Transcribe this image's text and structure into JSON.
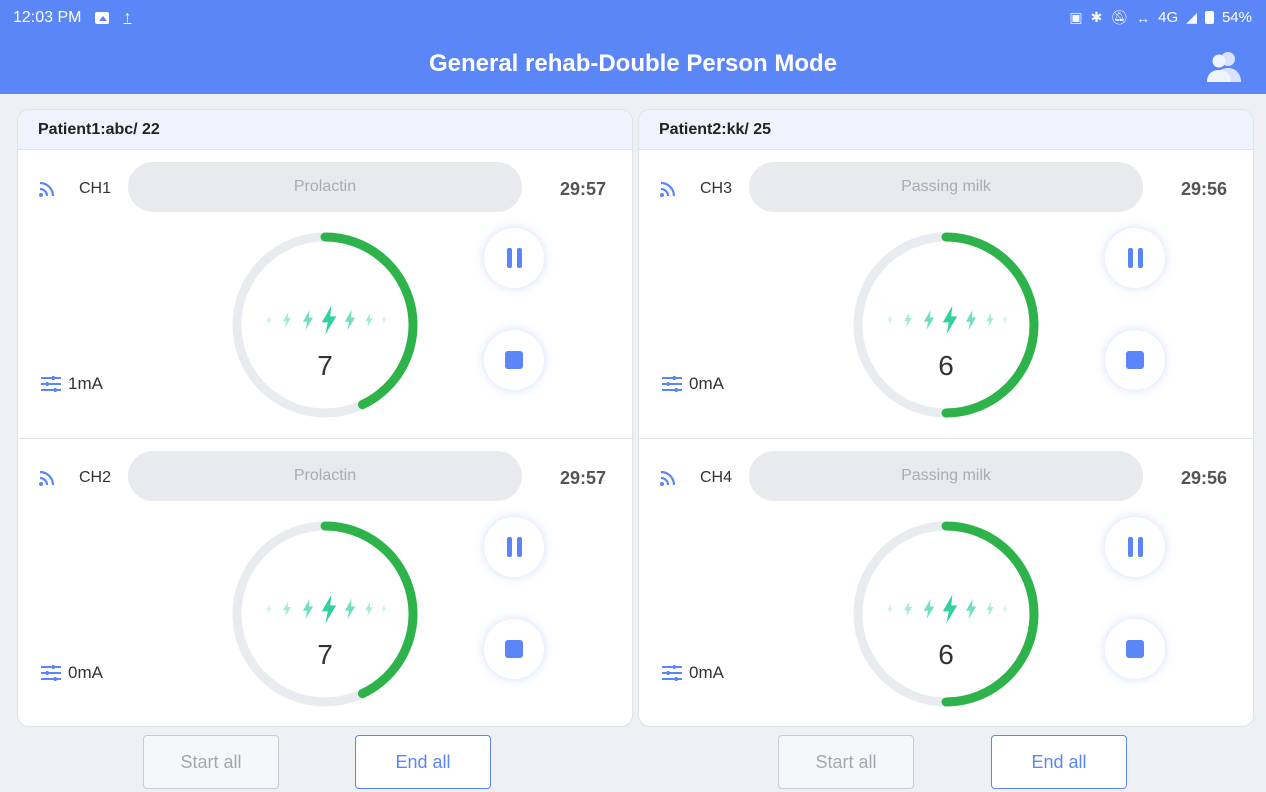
{
  "status_bar": {
    "time": "12:03 PM",
    "network": "4G",
    "battery": "54%"
  },
  "header": {
    "title": "General rehab-Double Person Mode"
  },
  "colors": {
    "accent": "#5b86f7",
    "progress": "#2db34a",
    "track": "#e8ebf0"
  },
  "panels": [
    {
      "title": "Patient1:abc/ 22",
      "channels": [
        {
          "name": "CH1",
          "program": "Prolactin",
          "timer": "29:57",
          "intensity": "7",
          "current": "1mA",
          "progress": 0.43
        },
        {
          "name": "CH2",
          "program": "Prolactin",
          "timer": "29:57",
          "intensity": "7",
          "current": "0mA",
          "progress": 0.43
        }
      ]
    },
    {
      "title": "Patient2:kk/ 25",
      "channels": [
        {
          "name": "CH3",
          "program": "Passing milk",
          "timer": "29:56",
          "intensity": "6",
          "current": "0mA",
          "progress": 0.5
        },
        {
          "name": "CH4",
          "program": "Passing milk",
          "timer": "29:56",
          "intensity": "6",
          "current": "0mA",
          "progress": 0.5
        }
      ]
    }
  ],
  "footer": {
    "start_all": "Start all",
    "end_all": "End all"
  }
}
